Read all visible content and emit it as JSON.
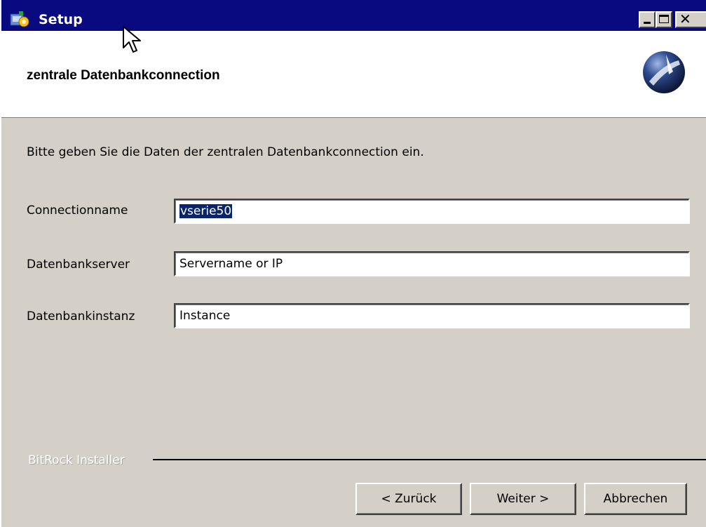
{
  "window": {
    "title": "Setup",
    "controls": [
      "minimize",
      "maximize",
      "close"
    ],
    "close_glyph": "✕"
  },
  "header": {
    "title": "zentrale Datenbankconnection",
    "logo_icon": "installer-globe-logo"
  },
  "body": {
    "instruction": "Bitte geben Sie die Daten der zentralen Datenbankconnection ein.",
    "fields": [
      {
        "label": "Connectionname",
        "value": "vserie50",
        "selected": true
      },
      {
        "label": "Datenbankserver",
        "value": "Servername or IP"
      },
      {
        "label": "Datenbankinstanz",
        "value": "Instance"
      }
    ]
  },
  "footer": {
    "brand": "BitRock Installer",
    "buttons": {
      "back": "< Zurück",
      "next": "Weiter >",
      "cancel": "Abbrechen"
    }
  },
  "colors": {
    "titlebar": "#0a0a80",
    "window_bg": "#d4d0c8",
    "header_bg": "#ffffff",
    "selection": "#0a246a"
  }
}
